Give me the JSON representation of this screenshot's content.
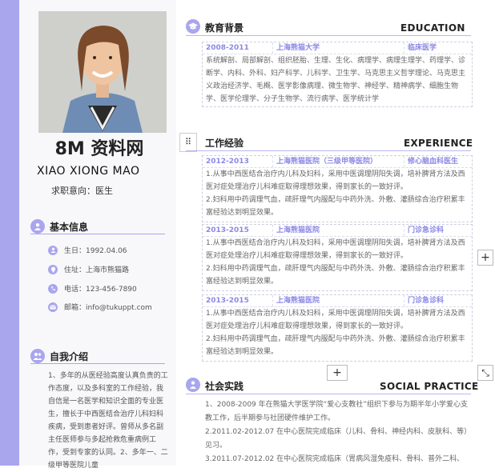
{
  "sidebar": {
    "brand": "8M 资料网",
    "name": "XIAO XIONG MAO",
    "intent": "求职意向：医生",
    "basic_info": {
      "title": "基本信息",
      "birthday": "生日：1992.04.06",
      "address": "住址：上海市熊猫路",
      "phone": "电话：123-456-7890",
      "email": "邮箱：info@tukuppt.com"
    },
    "self_intro": {
      "title": "自我介绍",
      "text": "1、多年的从医经验高度认真负责的工作态度，以及多科室的工作经验，我自信是一名医学和知识全面的专业医生，擅长于中西医结合治疗儿科妇科疾病，受到患者好评。曾师从多名副主任医师参与多起抢救危重病例工作，受到专家的认同。2、多年一、二级甲等医院儿童"
    }
  },
  "education": {
    "title": "教育背景",
    "title_en": "EDUCATION",
    "period": "2008-2011",
    "school": "上海熊猫大学",
    "major": "临床医学",
    "courses": "系统解剖、局部解剖、组织胚胎、生理、生化、病理学、病理生理学、药理学、诊断学、内科、外科、妇产科学、儿科学、卫生学、马克思主义哲学理论、马克思主义政治经济学、毛概、医学影像病理、微生物学、神经学、精神病学、细胞生物学、医学伦理学、分子生物学、流行病学、医学统计学"
  },
  "experience": {
    "title": "工作经验",
    "title_en": "EXPERIENCE",
    "entries": [
      {
        "period": "2012-2013",
        "org": "上海熊猫医院（三级甲等医院）",
        "role": "修心脑血科医生",
        "line1": "1.从事中西医结合治疗内儿科及妇科，采用中医调理阴阳失调，培补脾肾方法及西医对症处理治疗儿科难症取得理想效果，得到家长的一致好评。",
        "line2": "2.妇科用中药调理气血，疏肝理气内服配与中药外洗、外敷、灌肠综合治疗积累丰富经验达到明显效果。"
      },
      {
        "period": "2013-2015",
        "org": "上海熊猫医院",
        "role": "门诊急诊科",
        "line1": "1.从事中西医结合治疗内儿科及妇科，采用中医调理阴阳失调，培补脾肾方法及西医对症处理治疗儿科难症取得理想效果，得到家长的一致好评。",
        "line2": "2.妇科用中药调理气血，疏肝理气内服配与中药外洗、外敷、灌肠综合治疗积累丰富经验达到明显效果。"
      },
      {
        "period": "2013-2015",
        "org": "上海熊猫医院",
        "role": "门诊急诊科",
        "line1": "1.从事中西医结合治疗内儿科及妇科，采用中医调理阴阳失调，培补脾肾方法及西医对症处理治疗儿科难症取得理想效果，得到家长的一致好评。",
        "line2": "2.妇科用中药调理气血，疏肝理气内服配与中药外洗、外敷、灌肠综合治疗积累丰富经验达到明显效果。"
      }
    ]
  },
  "social": {
    "title": "社会实践",
    "title_en": "SOCIAL PRACTICE",
    "item1": "1、2008-2009 年在熊猫大学医学院“爱心支教社”组织下参与为期半年小学爱心支教工作，后半期参与社团硬件维护工作。",
    "item2": "2.2011.02-2012.07 在中心医院完成临床（儿科、骨科、神经内科、皮肤科、等）见习。",
    "item3": "3.2011.07-2012.02 在中心医院完成临床（胃病风湿免疫科、骨科、普外二科、"
  },
  "controls": {
    "plus": "+",
    "drag": "⠿",
    "expand": "⤡"
  },
  "colors": {
    "accent": "#a9a6ee",
    "accent_text": "#8b88e6"
  }
}
